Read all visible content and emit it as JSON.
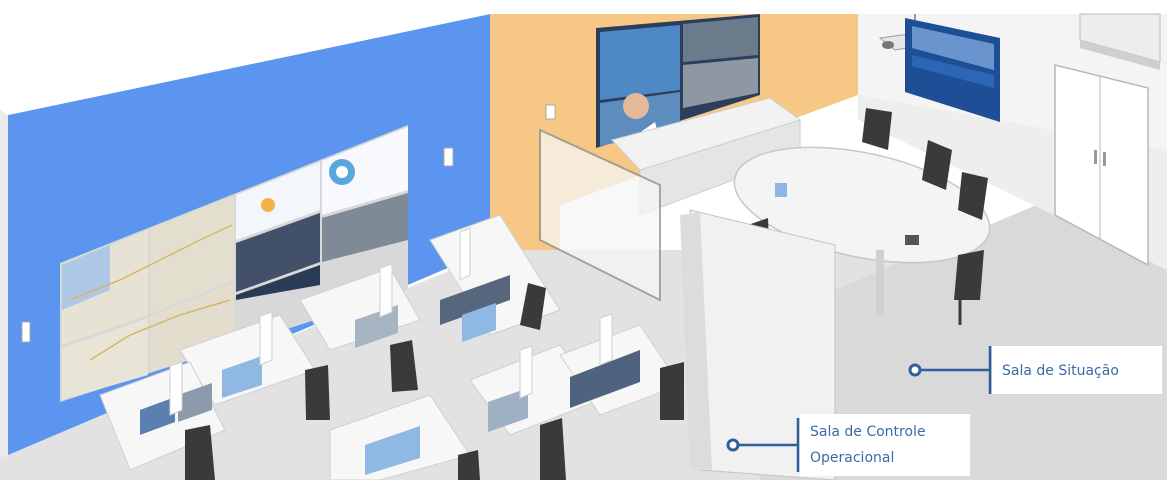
{
  "callouts": {
    "situation_room": {
      "line1": "Sala de Situação"
    },
    "control_room": {
      "line1": "Sala de Controle",
      "line2": "Operacional"
    }
  },
  "colors": {
    "blue_wall": "#5b95ef",
    "orange_wall": "#f6c785",
    "floor": "#dcdcdc",
    "accent_line": "#2f5f9e",
    "label_text": "#3a6aa8"
  },
  "icons": [
    "video-wall-icon",
    "desk-monitor-icon",
    "office-chair-icon",
    "conference-table-icon",
    "air-conditioner-icon",
    "projector-icon",
    "door-icon"
  ]
}
